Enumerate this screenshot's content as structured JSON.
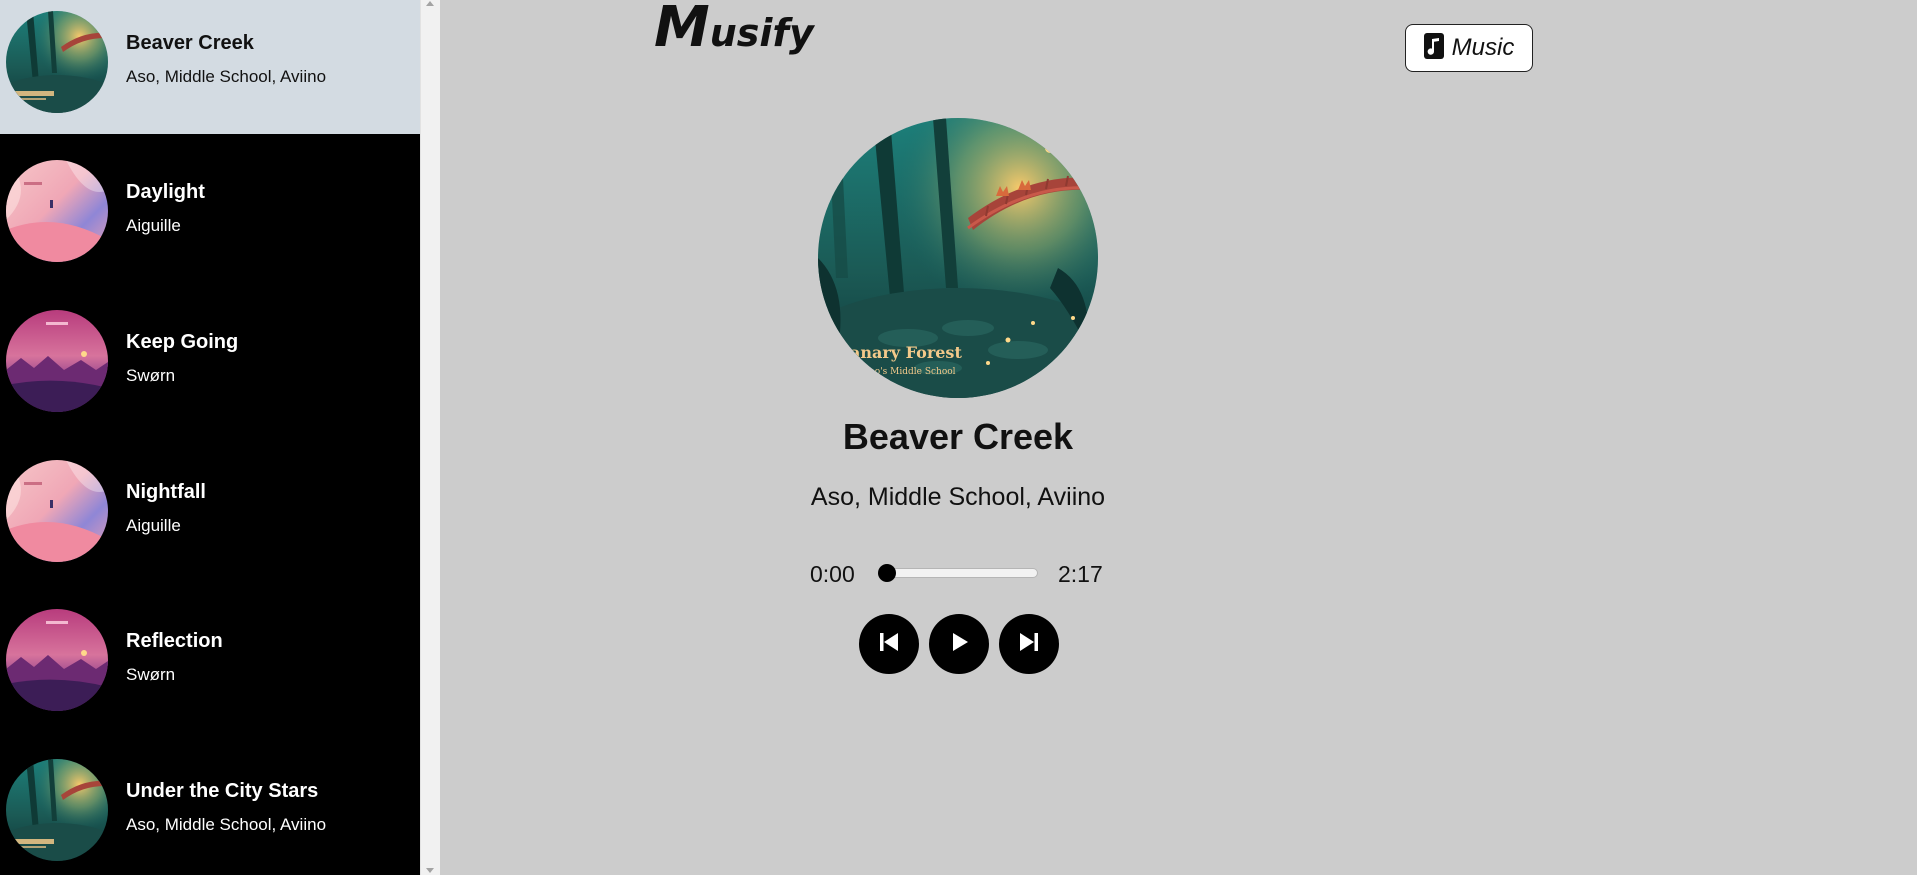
{
  "app": {
    "logo_initial": "M",
    "logo_rest": "usify",
    "nav_button_label": "Music",
    "nav_button_icon": "music-note-icon"
  },
  "playlist": [
    {
      "title": "Beaver Creek",
      "artist": "Aso, Middle School, Aviino",
      "art": "forest",
      "active": true
    },
    {
      "title": "Daylight",
      "artist": "Aiguille",
      "art": "pink-sky",
      "active": false
    },
    {
      "title": "Keep Going",
      "artist": "Swørn",
      "art": "magenta-city",
      "active": false
    },
    {
      "title": "Nightfall",
      "artist": "Aiguille",
      "art": "pink-sky",
      "active": false
    },
    {
      "title": "Reflection",
      "artist": "Swørn",
      "art": "magenta-city",
      "active": false
    },
    {
      "title": "Under the City Stars",
      "artist": "Aso, Middle School, Aviino",
      "art": "forest",
      "active": false
    }
  ],
  "now_playing": {
    "title": "Beaver Creek",
    "artist": "Aso, Middle School, Aviino",
    "cover_text_line1": "anary Forest",
    "cover_text_line2": "Aviino's Middle School",
    "current_time": "0:00",
    "duration": "2:17",
    "progress_fraction": 0.0
  },
  "controls": {
    "prev_icon": "skip-previous-icon",
    "play_icon": "play-icon",
    "next_icon": "skip-next-icon"
  },
  "colors": {
    "sidebar_bg": "#000000",
    "active_item_bg": "#d3dbe2",
    "main_bg": "#cccccc",
    "control_bg": "#000000"
  }
}
